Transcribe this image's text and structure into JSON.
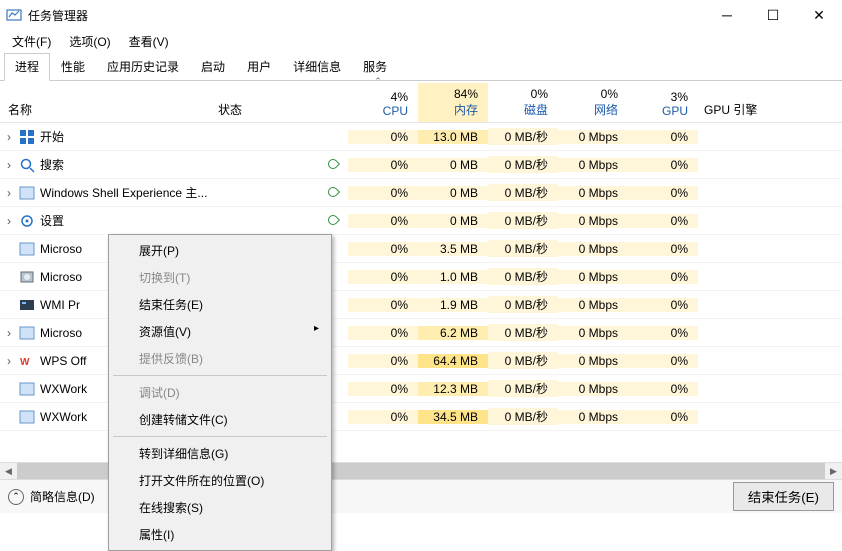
{
  "window": {
    "title": "任务管理器"
  },
  "menu": {
    "file": "文件(F)",
    "options": "选项(O)",
    "view": "查看(V)"
  },
  "tabs": [
    "进程",
    "性能",
    "应用历史记录",
    "启动",
    "用户",
    "详细信息",
    "服务"
  ],
  "headers": {
    "name": "名称",
    "status": "状态",
    "cpu_pct": "4%",
    "cpu_lbl": "CPU",
    "mem_pct": "84%",
    "mem_lbl": "内存",
    "disk_pct": "0%",
    "disk_lbl": "磁盘",
    "net_pct": "0%",
    "net_lbl": "网络",
    "gpu_pct": "3%",
    "gpu_lbl": "GPU",
    "gpu_engine": "GPU 引擎"
  },
  "rows": [
    {
      "exp": true,
      "icon": "start",
      "name": "开始",
      "leaf": false,
      "cpu": "0%",
      "mem": "13.0 MB",
      "disk": "0 MB/秒",
      "net": "0 Mbps",
      "gpu": "0%"
    },
    {
      "exp": true,
      "icon": "search",
      "name": "搜索",
      "leaf": true,
      "cpu": "0%",
      "mem": "0 MB",
      "disk": "0 MB/秒",
      "net": "0 Mbps",
      "gpu": "0%"
    },
    {
      "exp": true,
      "icon": "app",
      "name": "Windows Shell Experience 主...",
      "leaf": true,
      "cpu": "0%",
      "mem": "0 MB",
      "disk": "0 MB/秒",
      "net": "0 Mbps",
      "gpu": "0%"
    },
    {
      "exp": true,
      "icon": "gear",
      "name": "设置",
      "leaf": true,
      "cpu": "0%",
      "mem": "0 MB",
      "disk": "0 MB/秒",
      "net": "0 Mbps",
      "gpu": "0%"
    },
    {
      "exp": false,
      "icon": "app",
      "name": "Microso",
      "leaf": false,
      "cpu": "0%",
      "mem": "3.5 MB",
      "disk": "0 MB/秒",
      "net": "0 Mbps",
      "gpu": "0%"
    },
    {
      "exp": false,
      "icon": "disk",
      "name": "Microso",
      "leaf": false,
      "cpu": "0%",
      "mem": "1.0 MB",
      "disk": "0 MB/秒",
      "net": "0 Mbps",
      "gpu": "0%"
    },
    {
      "exp": false,
      "icon": "wmi",
      "name": "WMI Pr",
      "leaf": false,
      "cpu": "0%",
      "mem": "1.9 MB",
      "disk": "0 MB/秒",
      "net": "0 Mbps",
      "gpu": "0%"
    },
    {
      "exp": true,
      "icon": "app",
      "name": "Microso",
      "leaf": false,
      "cpu": "0%",
      "mem": "6.2 MB",
      "disk": "0 MB/秒",
      "net": "0 Mbps",
      "gpu": "0%"
    },
    {
      "exp": true,
      "icon": "wps",
      "name": "WPS Off",
      "leaf": false,
      "cpu": "0%",
      "mem": "64.4 MB",
      "disk": "0 MB/秒",
      "net": "0 Mbps",
      "gpu": "0%"
    },
    {
      "exp": false,
      "icon": "app",
      "name": "WXWork",
      "leaf": false,
      "cpu": "0%",
      "mem": "12.3 MB",
      "disk": "0 MB/秒",
      "net": "0 Mbps",
      "gpu": "0%"
    },
    {
      "exp": false,
      "icon": "app",
      "name": "WXWork",
      "leaf": false,
      "cpu": "0%",
      "mem": "34.5 MB",
      "disk": "0 MB/秒",
      "net": "0 Mbps",
      "gpu": "0%"
    }
  ],
  "context_menu": {
    "expand": "展开(P)",
    "switchto": "切换到(T)",
    "endtask": "结束任务(E)",
    "resource": "资源值(V)",
    "feedback": "提供反馈(B)",
    "debug": "调试(D)",
    "dump": "创建转储文件(C)",
    "details": "转到详细信息(G)",
    "openloc": "打开文件所在的位置(O)",
    "search": "在线搜索(S)",
    "props": "属性(I)"
  },
  "footer": {
    "brief": "简略信息(D)",
    "end": "结束任务(E)"
  }
}
